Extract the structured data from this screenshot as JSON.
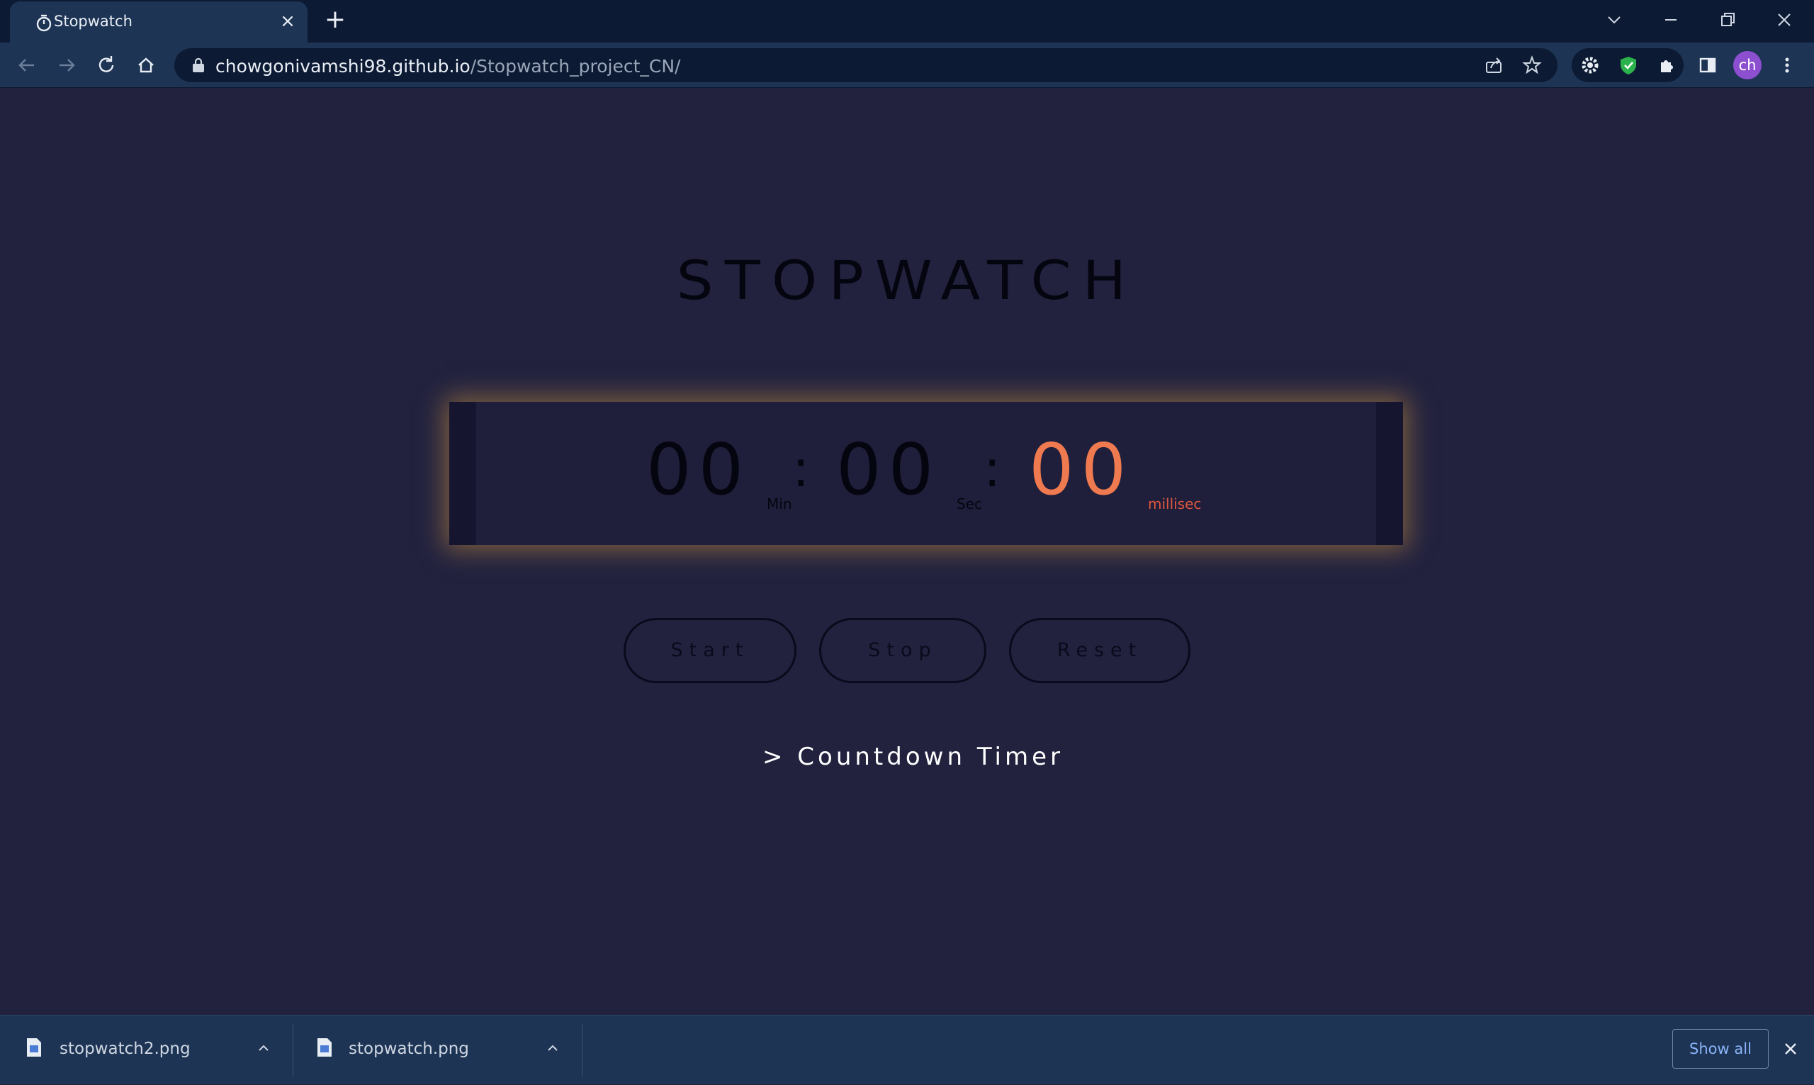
{
  "browser": {
    "tab_title": "Stopwatch",
    "url_host": "chowgonivamshi98.github.io",
    "url_path": "/Stopwatch_project_CN/",
    "avatar_initials": "ch",
    "icons": [
      "stopwatch-favicon-icon",
      "close-icon",
      "plus-icon",
      "chevron-down-icon",
      "minimize-icon",
      "restore-icon",
      "close-window-icon",
      "back-arrow-icon",
      "forward-arrow-icon",
      "reload-icon",
      "home-icon",
      "lock-icon",
      "share-icon",
      "star-icon",
      "gear-extension-icon",
      "shield-extension-icon",
      "puzzle-icon",
      "side-panel-icon",
      "more-vert-icon"
    ]
  },
  "page": {
    "title": "STOPWATCH",
    "minutes": "00",
    "seconds": "00",
    "milliseconds": "00",
    "separator": ":",
    "unit_min": "Min",
    "unit_sec": "Sec",
    "unit_ms": "millisec",
    "buttons": {
      "start": "Start",
      "stop": "Stop",
      "reset": "Reset"
    },
    "countdown_link": "> Countdown Timer",
    "colors": {
      "background": "#22223f",
      "accent": "#f07a4f",
      "glow": "#d2963c"
    }
  },
  "downloads": {
    "items": [
      {
        "name": "stopwatch2.png"
      },
      {
        "name": "stopwatch.png"
      }
    ],
    "show_all": "Show all"
  }
}
